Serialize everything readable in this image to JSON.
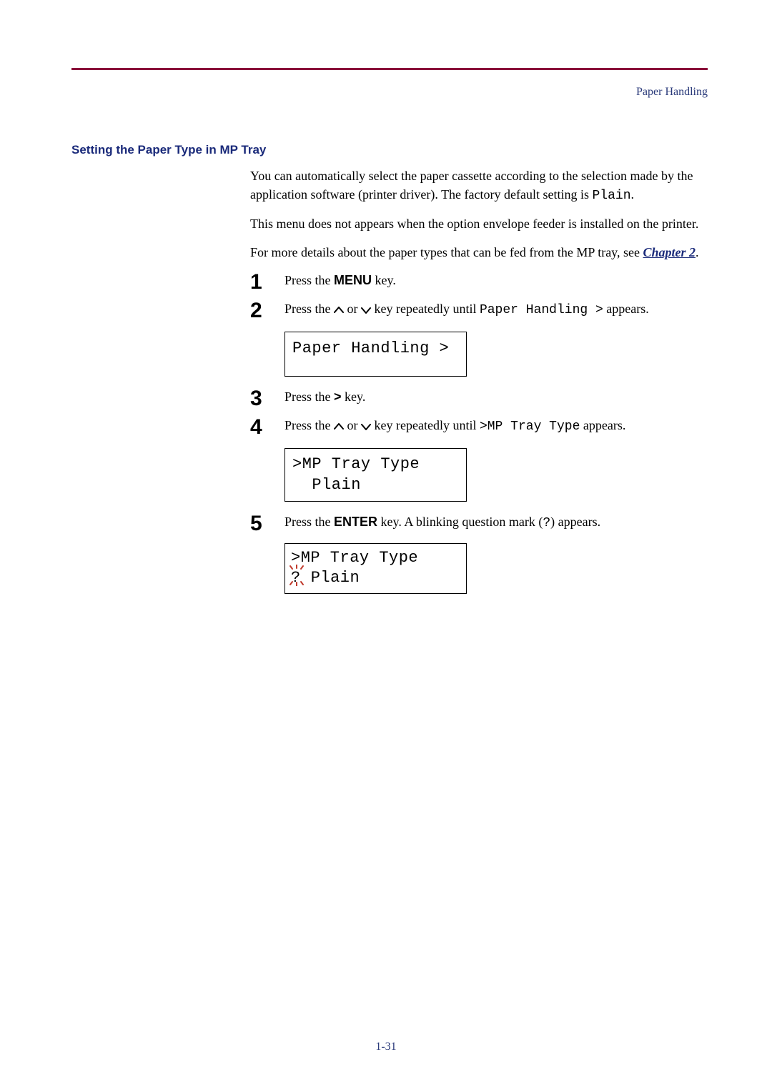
{
  "header": {
    "label": "Paper Handling"
  },
  "section": {
    "title": "Setting the Paper Type in MP Tray"
  },
  "intro": {
    "p1_a": "You can automatically select the paper cassette according to the selection made by the application software (printer driver). The factory default setting is ",
    "p1_mono": "Plain",
    "p1_b": ".",
    "p2": "This menu does not appears when the option envelope feeder is installed on the printer.",
    "p3_a": "For more details about the paper types that can be fed from the MP tray, see ",
    "p3_link": "Chapter 2",
    "p3_b": "."
  },
  "steps": {
    "s1": {
      "num": "1",
      "a": "Press the ",
      "key": "MENU",
      "b": " key."
    },
    "s2": {
      "num": "2",
      "a": "Press the ",
      "mid": " or ",
      "b": " key repeatedly until ",
      "mono": "Paper Handling >",
      "c": " appears.",
      "display": "Paper Handling >"
    },
    "s3": {
      "num": "3",
      "a": "Press the ",
      "key": ">",
      "b": " key."
    },
    "s4": {
      "num": "4",
      "a": "Press the ",
      "mid": " or ",
      "b": " key repeatedly until ",
      "mono": ">MP Tray Type",
      "c": " appears.",
      "display_l1": ">MP Tray Type",
      "display_l2": "  Plain"
    },
    "s5": {
      "num": "5",
      "a": "Press the ",
      "key": "ENTER",
      "b": " key. A blinking question mark (",
      "mono": "?",
      "c": ") appears.",
      "display_l1": ">MP Tray Type",
      "display_q": "?",
      "display_rest": " Plain"
    }
  },
  "footer": {
    "pagenum": "1-31"
  }
}
